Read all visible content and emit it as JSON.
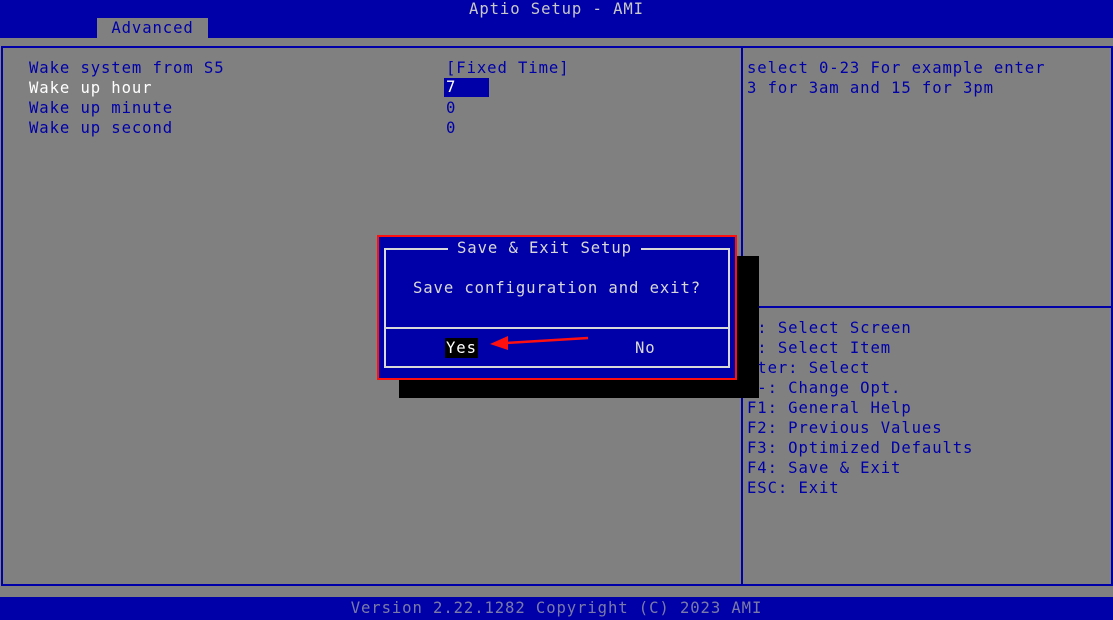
{
  "app": {
    "title": "Aptio Setup - AMI"
  },
  "tabs": [
    {
      "label": "Advanced",
      "active": true
    }
  ],
  "settings": [
    {
      "label": "Wake system from S5",
      "value": "[Fixed Time]"
    },
    {
      "label": "Wake up hour",
      "value": "7",
      "selected": true
    },
    {
      "label": "Wake up minute",
      "value": "0"
    },
    {
      "label": "Wake up second",
      "value": "0"
    }
  ],
  "help": {
    "description": [
      "select 0-23 For example enter",
      "3 for 3am and 15 for 3pm"
    ],
    "keys": [
      "←: Select Screen",
      "↓: Select Item",
      "nter: Select",
      "/-: Change Opt.",
      "F1: General Help",
      "F2: Previous Values",
      "F3: Optimized Defaults",
      "F4: Save & Exit",
      "ESC: Exit"
    ]
  },
  "dialog": {
    "title": "Save & Exit Setup",
    "message": "Save configuration and exit?",
    "yes_label": "Yes",
    "no_label": "No"
  },
  "footer": {
    "version": "Version 2.22.1282 Copyright (C) 2023 AMI"
  },
  "colors": {
    "bios_blue": "#0000a8",
    "background_gray": "#808080",
    "highlight_red": "#ff1010",
    "text_white": "#ffffff"
  },
  "icons": {
    "annotation": "red-arrow-icon"
  }
}
